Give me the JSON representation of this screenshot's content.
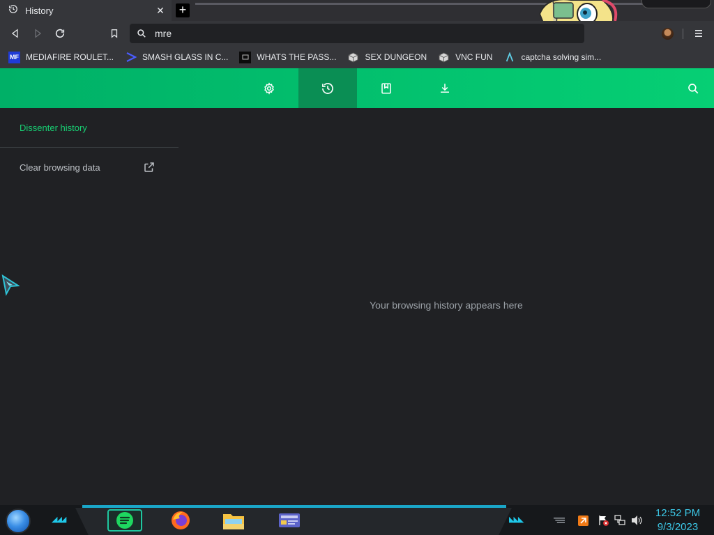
{
  "browser": {
    "tab": {
      "title": "History",
      "icon": "history-icon"
    },
    "omnibox": {
      "value": "mre",
      "icon": "search-icon"
    }
  },
  "bookmarks": [
    {
      "label": "MEDIAFIRE ROULET...",
      "icon": "mediafire-icon",
      "icon_text": "MF"
    },
    {
      "label": "SMASH GLASS IN C...",
      "icon": "prompt-icon"
    },
    {
      "label": "WHATS THE PASS...",
      "icon": "terminal-icon"
    },
    {
      "label": "SEX DUNGEON",
      "icon": "cube-icon"
    },
    {
      "label": "VNC FUN",
      "icon": "cube-icon"
    },
    {
      "label": "captcha solving sim...",
      "icon": "lambda-icon"
    }
  ],
  "header": {
    "buttons": [
      "settings-icon",
      "history-icon",
      "bookmarks-icon",
      "downloads-icon"
    ],
    "active": "history-icon",
    "search": "search-icon"
  },
  "sidenav": {
    "history_label": "Dissenter history",
    "clear_label": "Clear browsing data"
  },
  "main": {
    "empty_message": "Your browsing history appears here"
  },
  "taskbar": {
    "time": "12:52 PM",
    "date": "9/3/2023",
    "apps": [
      "spotify-icon",
      "firefox-icon",
      "file-explorer-icon",
      "control-panel-icon"
    ]
  },
  "colors": {
    "accent": "#06cf74",
    "active_tab": "#0a8e54",
    "link": "#18cf73",
    "clock": "#3cc7e6"
  }
}
